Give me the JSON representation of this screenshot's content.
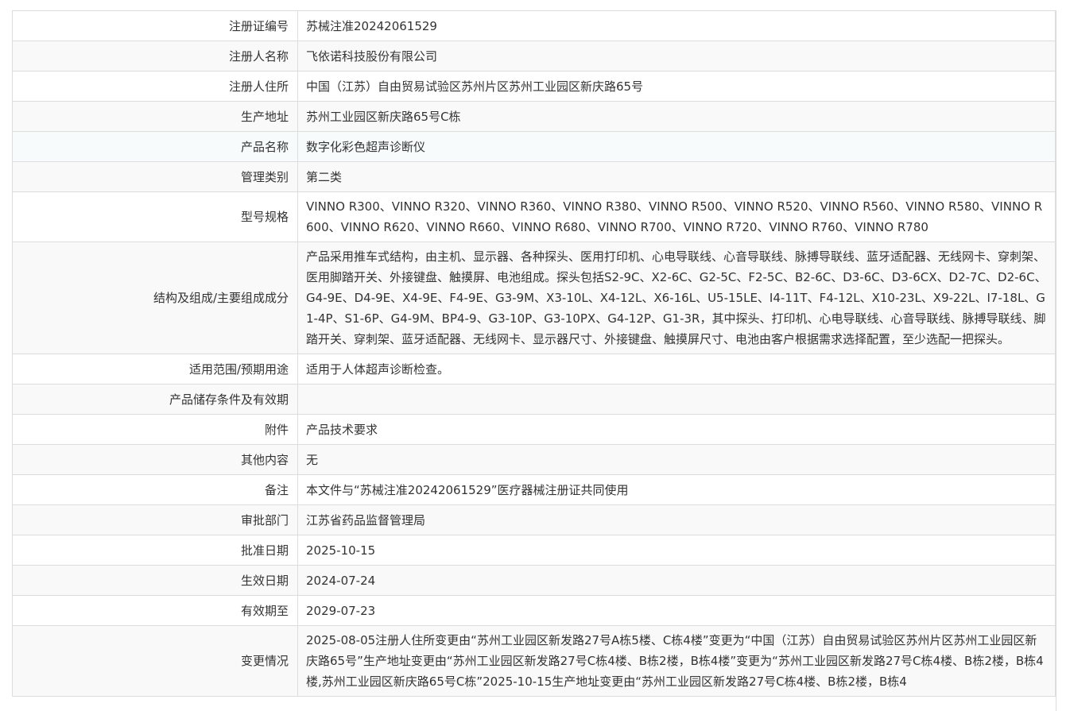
{
  "rows": [
    {
      "label": "注册证编号",
      "value": "苏械注准20242061529"
    },
    {
      "label": "注册人名称",
      "value": "飞依诺科技股份有限公司"
    },
    {
      "label": "注册人住所",
      "value": "中国（江苏）自由贸易试验区苏州片区苏州工业园区新庆路65号"
    },
    {
      "label": "生产地址",
      "value": "苏州工业园区新庆路65号C栋"
    },
    {
      "label": "产品名称",
      "value": "数字化彩色超声诊断仪"
    },
    {
      "label": "管理类别",
      "value": "第二类"
    },
    {
      "label": "型号规格",
      "value": "VINNO R300、VINNO R320、VINNO R360、VINNO R380、VINNO R500、VINNO R520、VINNO R560、VINNO R580、VINNO R600、VINNO R620、VINNO R660、VINNO R680、VINNO R700、VINNO R720、VINNO R760、VINNO R780"
    },
    {
      "label": "结构及组成/主要组成成分",
      "value": "产品采用推车式结构，由主机、显示器、各种探头、医用打印机、心电导联线、心音导联线、脉搏导联线、蓝牙适配器、无线网卡、穿刺架、医用脚踏开关、外接键盘、触摸屏、电池组成。探头包括S2-9C、X2-6C、G2-5C、F2-5C、B2-6C、D3-6C、D3-6CX、D2-7C、D2-6C、G4-9E、D4-9E、X4-9E、F4-9E、G3-9M、X3-10L、X4-12L、X6-16L、U5-15LE、I4-11T、F4-12L、X10-23L、X9-22L、I7-18L、G1-4P、S1-6P、G4-9M、BP4-9、G3-10P、G3-10PX、G4-12P、G1-3R，其中探头、打印机、心电导联线、心音导联线、脉搏导联线、脚踏开关、穿刺架、蓝牙适配器、无线网卡、显示器尺寸、外接键盘、触摸屏尺寸、电池由客户根据需求选择配置，至少选配一把探头。"
    },
    {
      "label": "适用范围/预期用途",
      "value": "适用于人体超声诊断检查。"
    },
    {
      "label": "产品储存条件及有效期",
      "value": ""
    },
    {
      "label": "附件",
      "value": "产品技术要求"
    },
    {
      "label": "其他内容",
      "value": "无"
    },
    {
      "label": "备注",
      "value": "本文件与“苏械注准20242061529”医疗器械注册证共同使用"
    },
    {
      "label": "审批部门",
      "value": "江苏省药品监督管理局"
    },
    {
      "label": "批准日期",
      "value": "2025-10-15"
    },
    {
      "label": "生效日期",
      "value": "2024-07-24"
    },
    {
      "label": "有效期至",
      "value": "2029-07-23"
    },
    {
      "label": "变更情况",
      "value": "2025-08-05注册人住所变更由“苏州工业园区新发路27号A栋5楼、C栋4楼”变更为“中国（江苏）自由贸易试验区苏州片区苏州工业园区新庆路65号”生产地址变更由“苏州工业园区新发路27号C栋4楼、B栋2楼，B栋4楼”变更为“苏州工业园区新发路27号C栋4楼、B栋2楼，B栋4楼,苏州工业园区新庆路65号C栋”2025-10-15生产地址变更由“苏州工业园区新发路27号C栋4楼、B栋2楼，B栋4"
    }
  ]
}
